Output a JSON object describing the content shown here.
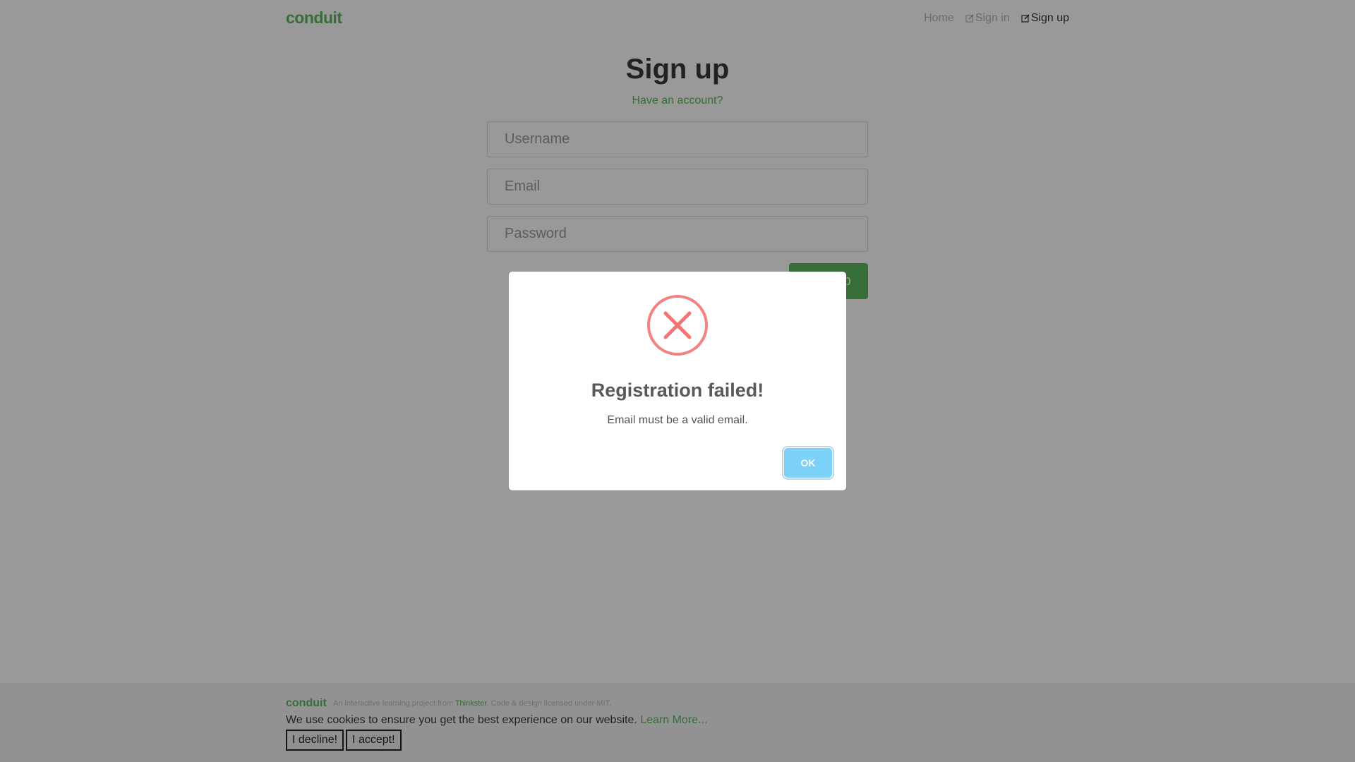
{
  "brand": "conduit",
  "nav": {
    "home": "Home",
    "sign_in": "Sign in",
    "sign_up": "Sign up"
  },
  "form": {
    "title": "Sign up",
    "have_account": "Have an account?",
    "username_placeholder": "Username",
    "email_placeholder": "Email",
    "password_placeholder": "Password",
    "submit_label": "Sign up"
  },
  "modal": {
    "icon": "error-x-icon",
    "title": "Registration failed!",
    "text": "Email must be a valid email.",
    "ok_label": "OK"
  },
  "footer": {
    "logo": "conduit",
    "attribution_prefix": "An interactive learning project from",
    "attribution_link": "Thinkster",
    "attribution_suffix": ". Code & design licensed under MIT.",
    "cookie_text": "We use cookies to ensure you get the best experience on our website.",
    "learn_more": "Learn More...",
    "decline": "I decline!",
    "accept": "I accept!"
  },
  "colors": {
    "brand": "#5cb85c",
    "ok_button": "#7cd1f9",
    "error_icon": "#f27474"
  }
}
